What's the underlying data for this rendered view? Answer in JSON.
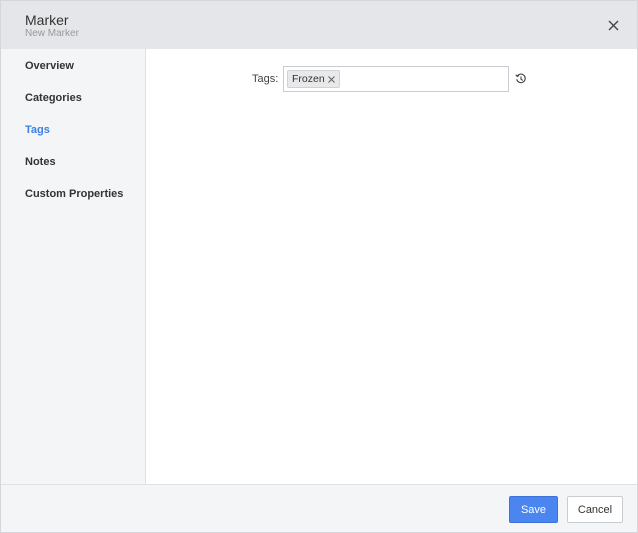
{
  "header": {
    "title": "Marker",
    "subtitle": "New Marker",
    "close_icon": "close-icon"
  },
  "sidebar": {
    "items": [
      {
        "label": "Overview"
      },
      {
        "label": "Categories"
      },
      {
        "label": "Tags"
      },
      {
        "label": "Notes"
      },
      {
        "label": "Custom Properties"
      }
    ],
    "active": "Tags"
  },
  "tags_panel": {
    "label": "Tags:",
    "chips": [
      {
        "label": "Frozen"
      }
    ],
    "chip_remove_icon": "close-icon",
    "history_icon": "history-icon"
  },
  "footer": {
    "save_label": "Save",
    "cancel_label": "Cancel"
  },
  "colors": {
    "accent": "#4b85f0",
    "active_nav": "#3d7fe6",
    "header_bg": "#e5e6e9",
    "sidebar_bg": "#f4f5f7"
  }
}
